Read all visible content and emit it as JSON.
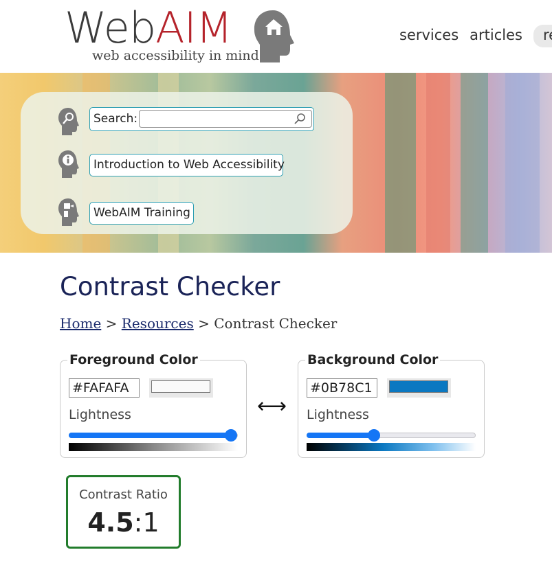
{
  "header": {
    "logo": {
      "word_web": "Web",
      "word_aim": "AIM",
      "tagline": "web accessibility in mind"
    },
    "nav": [
      {
        "label": "services"
      },
      {
        "label": "articles"
      },
      {
        "label": "re"
      }
    ]
  },
  "banner": {
    "search": {
      "label": "Search:",
      "value": "",
      "placeholder": ""
    },
    "links": [
      {
        "label": "Introduction to Web Accessibility"
      },
      {
        "label": "WebAIM Training"
      }
    ]
  },
  "page": {
    "title": "Contrast Checker",
    "breadcrumb": [
      {
        "label": "Home",
        "link": true
      },
      {
        "label": "Resources",
        "link": true
      },
      {
        "label": "Contrast Checker",
        "link": false
      }
    ],
    "breadcrumb_separator": ">"
  },
  "foreground": {
    "legend": "Foreground Color",
    "hex": "#FAFAFA",
    "swatch_color": "#FAFAFA",
    "lightness_label": "Lightness",
    "lightness_fraction": 0.96
  },
  "background": {
    "legend": "Background Color",
    "hex": "#0B78C1",
    "swatch_color": "#0B78C1",
    "lightness_label": "Lightness",
    "lightness_fraction": 0.4
  },
  "swap_symbol": "⟷",
  "result": {
    "label": "Contrast Ratio",
    "ratio_main": "4.5",
    "ratio_suffix": ":1"
  },
  "colors": {
    "title": "#1a2357",
    "accent_blue": "#1576f5",
    "pass_green": "#227c2c",
    "logo_red": "#b5232b",
    "link_border": "#2a9db1"
  }
}
